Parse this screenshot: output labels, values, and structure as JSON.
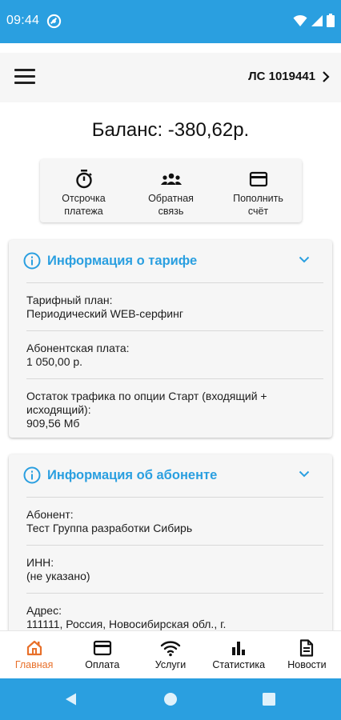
{
  "status_bar": {
    "time": "09:44",
    "icons": [
      "vpn-icon",
      "wifi-icon",
      "signal-icon",
      "battery-icon"
    ]
  },
  "app_bar": {
    "menu_icon": "hamburger-menu-icon",
    "account_label": "ЛС 1019441"
  },
  "balance": {
    "text": "Баланс: -380,62р."
  },
  "actions": [
    {
      "label": "Отсрочка\nплатежа",
      "icon": "stopwatch-icon"
    },
    {
      "label": "Обратная\nсвязь",
      "icon": "group-icon"
    },
    {
      "label": "Пополнить\nсчёт",
      "icon": "credit-card-icon"
    }
  ],
  "tariff_card": {
    "title": "Информация о тарифе",
    "rows": [
      {
        "label": "Тарифный план:",
        "value": "Периодический WEB-серфинг"
      },
      {
        "label": "Абонентская плата:",
        "value": "1 050,00 р."
      },
      {
        "label": "Остаток трафика по опции Старт (входящий + исходящий):",
        "value": "909,56 Мб"
      }
    ]
  },
  "subscriber_card": {
    "title": "Информация об абоненте",
    "rows": [
      {
        "label": "Абонент:",
        "value": "Тест Группа разработки Сибирь"
      },
      {
        "label": "ИНН:",
        "value": "(не указано)"
      },
      {
        "label": "Адрес:",
        "value": "111111,  Россия,  Новосибирская обл., г."
      }
    ]
  },
  "bottom_nav": [
    {
      "label": "Главная",
      "icon": "home-icon",
      "active": true
    },
    {
      "label": "Оплата",
      "icon": "card-icon",
      "active": false
    },
    {
      "label": "Услуги",
      "icon": "wifi-icon",
      "active": false
    },
    {
      "label": "Статистика",
      "icon": "bar-chart-icon",
      "active": false
    },
    {
      "label": "Новости",
      "icon": "document-icon",
      "active": false
    }
  ],
  "colors": {
    "accent": "#2a9fe0",
    "active_nav": "#e8702a",
    "card_bg": "#f6f6f6"
  }
}
